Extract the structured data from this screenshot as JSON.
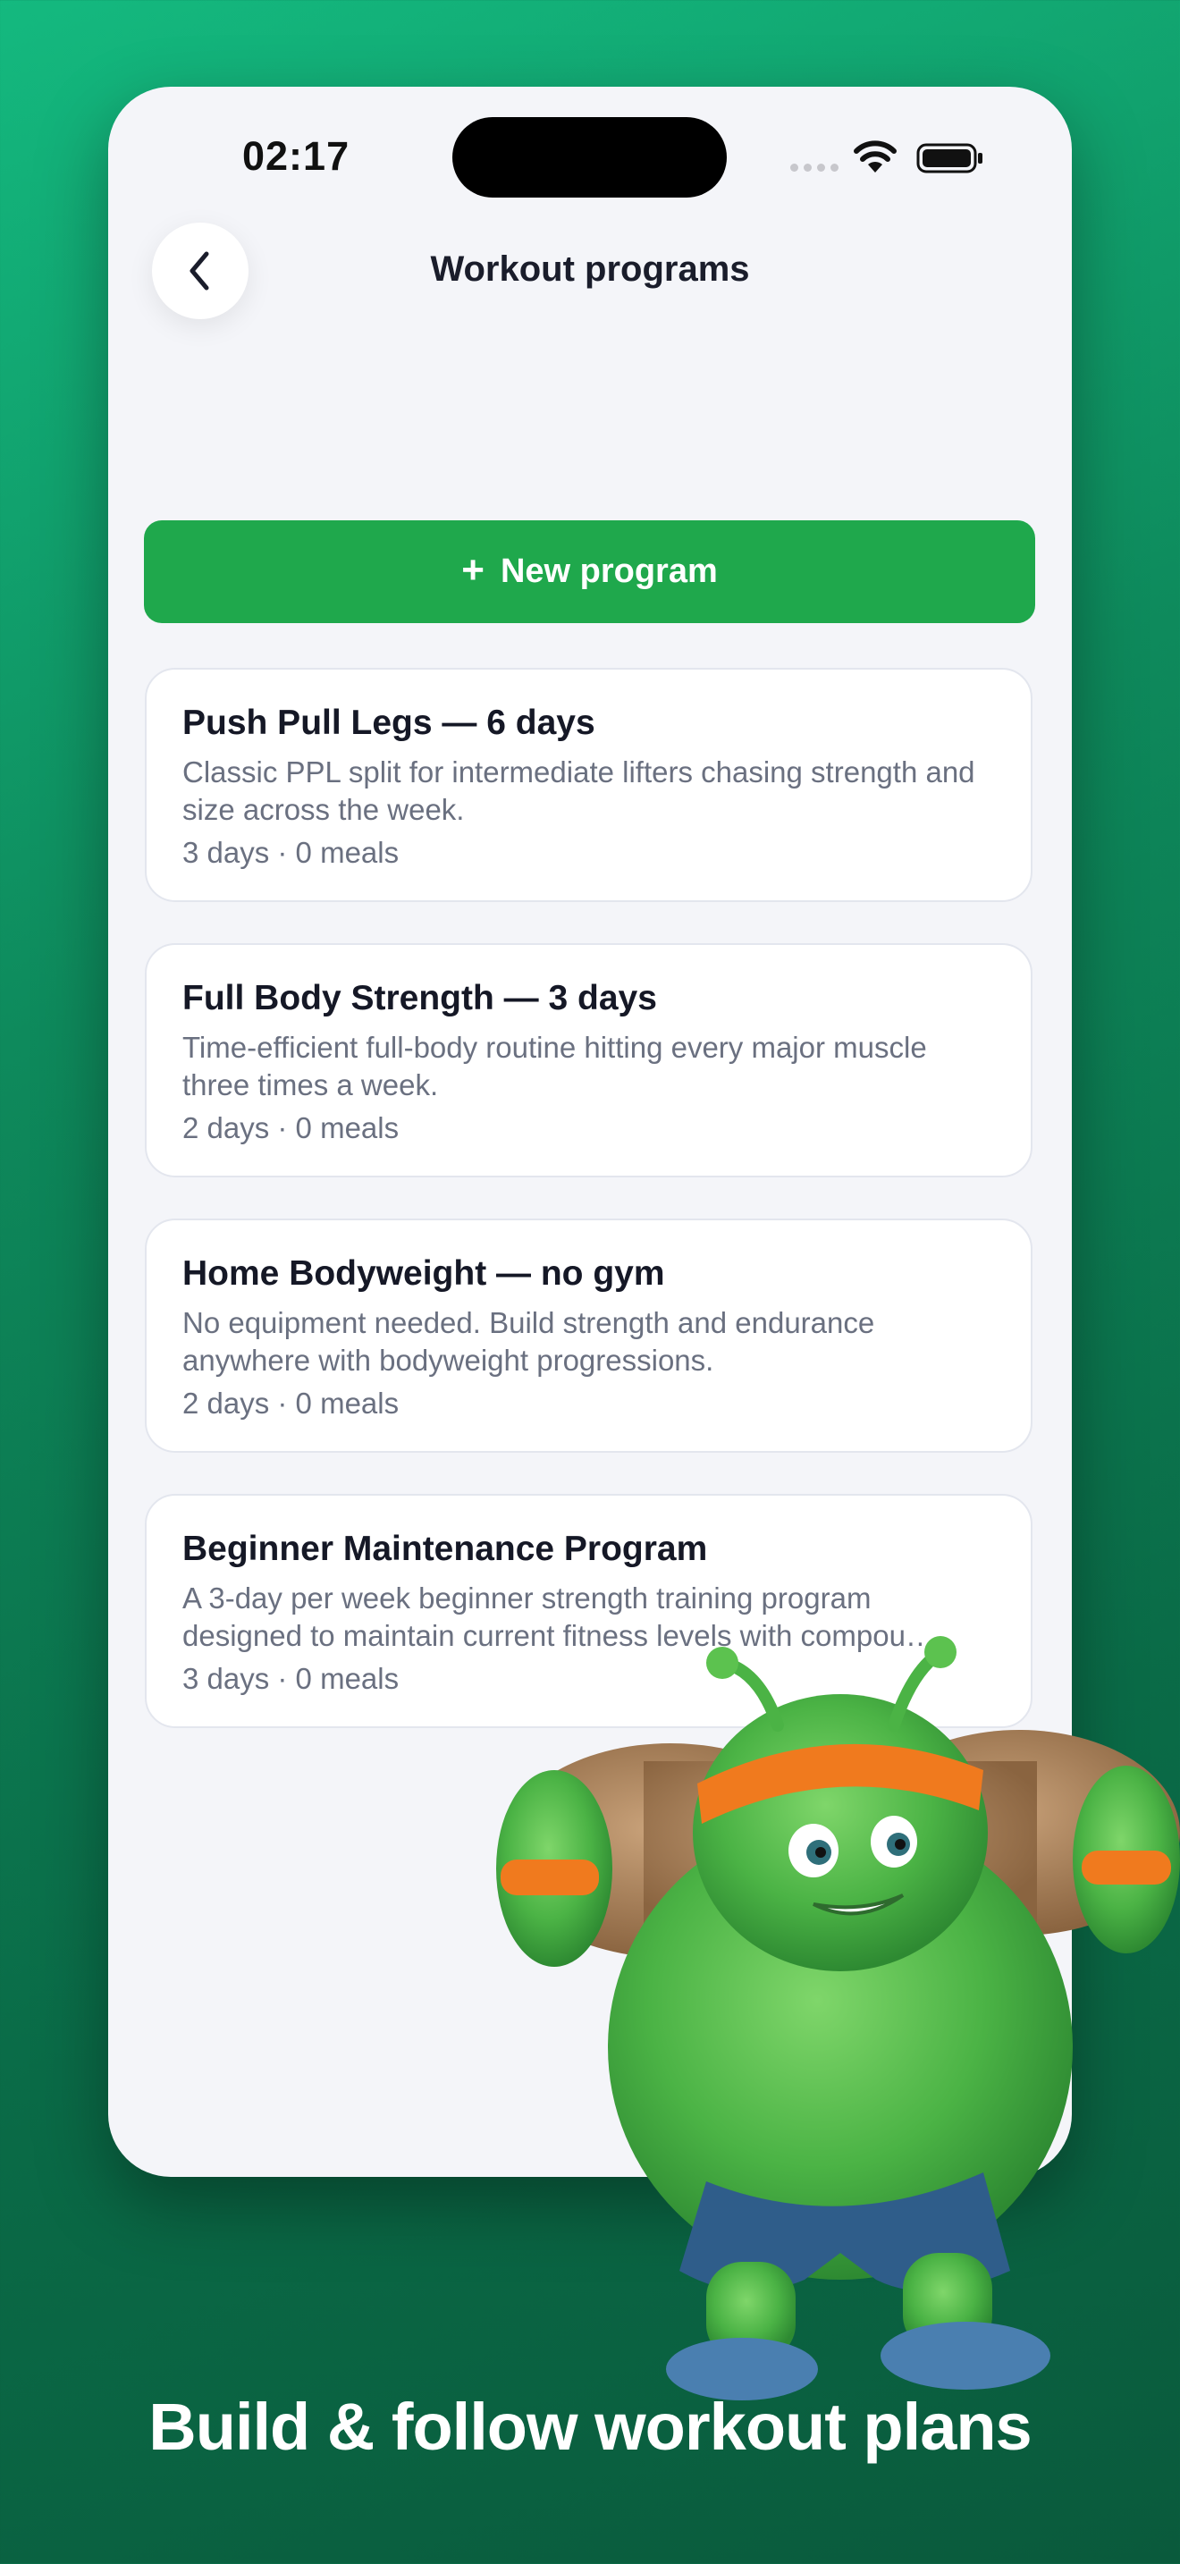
{
  "status": {
    "time": "02:17"
  },
  "header": {
    "title": "Workout programs",
    "back_icon": "chevron-left-icon"
  },
  "new_program": {
    "icon": "plus-icon",
    "label": "New program"
  },
  "programs": [
    {
      "title": "Push Pull Legs — 6 days",
      "description": "Classic PPL split for intermediate lifters chasing strength and size across the week.",
      "meta": "3 days · 0 meals"
    },
    {
      "title": "Full Body Strength — 3 days",
      "description": "Time-efficient full-body routine hitting every major muscle three times a week.",
      "meta": "2 days · 0 meals"
    },
    {
      "title": "Home Bodyweight — no gym",
      "description": "No equipment needed. Build strength and endurance anywhere with bodyweight progressions.",
      "meta": "2 days · 0 meals"
    },
    {
      "title": "Beginner Maintenance Program",
      "description": "A 3-day per week beginner strength training program designed to maintain current fitness levels with compou…",
      "meta": "3 days · 0 meals"
    }
  ],
  "colors": {
    "accent": "#1fa84c",
    "background": "#0e8a5c",
    "surface": "#f4f5f9"
  },
  "caption": "Build & follow workout plans"
}
